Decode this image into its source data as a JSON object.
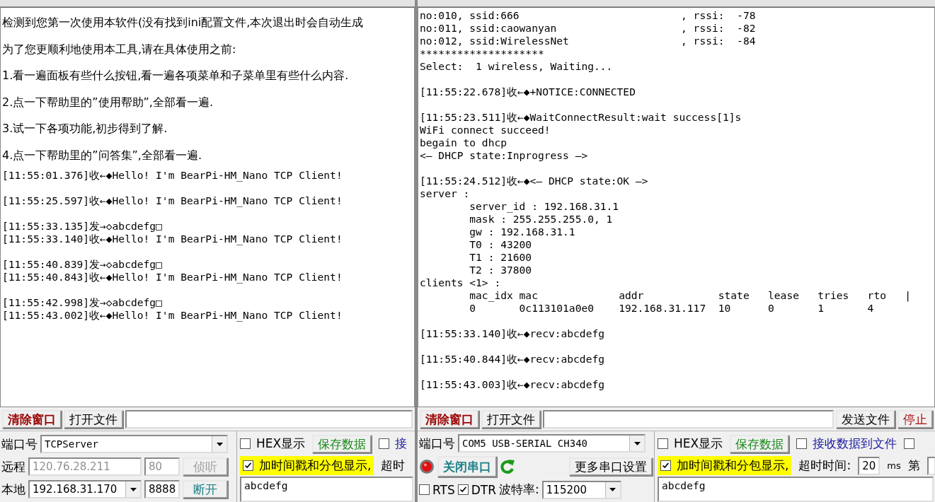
{
  "left_window": {
    "notice": [
      "检测到您第一次使用本软件(没有找到ini配置文件,本次退出时会自动生成",
      "为了您更顺利地使用本工具,请在具体使用之前:",
      "1.看一遍面板有些什么按钮,看一遍各项菜单和子菜单里有些什么内容.",
      "2.点一下帮助里的”使用帮助”,全部看一遍.",
      "3.试一下各项功能,初步得到了解.",
      "4.点一下帮助里的”问答集”,全部看一遍."
    ],
    "log_blocks": [
      [
        "[11:55:01.376]收←◆Hello! I'm BearPi-HM_Nano TCP Client!"
      ],
      [
        "[11:55:25.597]收←◆Hello! I'm BearPi-HM_Nano TCP Client!"
      ],
      [
        "[11:55:33.135]发→◇abcdefg□",
        "[11:55:33.140]收←◆Hello! I'm BearPi-HM_Nano TCP Client!"
      ],
      [
        "[11:55:40.839]发→◇abcdefg□",
        "[11:55:40.843]收←◆Hello! I'm BearPi-HM_Nano TCP Client!"
      ],
      [
        "[11:55:42.998]发→◇abcdefg□",
        "[11:55:43.002]收←◆Hello! I'm BearPi-HM_Nano TCP Client!"
      ]
    ],
    "toolbar": [
      {
        "kind": "button",
        "label": "清除窗口",
        "color": "#990000",
        "emphasis": true
      },
      {
        "kind": "button",
        "label": "打开文件"
      },
      {
        "kind": "field"
      }
    ],
    "port": {
      "label": "端口号",
      "value": "TCPServer"
    },
    "remote": {
      "label": "远程",
      "address": "120.76.28.211",
      "port": "80",
      "button": "侦听",
      "disabled": true
    },
    "local": {
      "label": "本地",
      "address": "192.168.31.170",
      "port": "8888",
      "button": {
        "label": "断开",
        "color": "#1a7f86"
      }
    },
    "options": [
      [
        {
          "kind": "checkbox",
          "label": "HEX显示",
          "checked": false
        },
        {
          "kind": "button",
          "label": "保存数据",
          "color": "#1a8a1a"
        },
        {
          "kind": "checkbox",
          "label": "接",
          "checked": false,
          "color": "#1a1aa0"
        }
      ],
      [
        {
          "kind": "checkbox",
          "label": "加时间戳和分包显示,",
          "checked": true,
          "highlight": true
        },
        {
          "kind": "label",
          "label": "超时"
        }
      ]
    ],
    "send_text": "abcdefg"
  },
  "right_window": {
    "log_blocks": [
      [
        "no:010, ssid:666                          , rssi:  -78",
        "no:011, ssid:caowanyan                    , rssi:  -82",
        "no:012, ssid:WirelessNet                  , rssi:  -84",
        "********************",
        "Select:  1 wireless, Waiting..."
      ],
      [
        "[11:55:22.678]收←◆+NOTICE:CONNECTED"
      ],
      [
        "[11:55:23.511]收←◆WaitConnectResult:wait success[1]s",
        "WiFi connect succeed!",
        "begain to dhcp",
        "<— DHCP state:Inprogress —>"
      ],
      [
        "[11:55:24.512]收←◆<— DHCP state:OK —>",
        "server :",
        "        server_id : 192.168.31.1",
        "        mask : 255.255.255.0, 1",
        "        gw : 192.168.31.1",
        "        T0 : 43200",
        "        T1 : 21600",
        "        T2 : 37800",
        "clients <1> :",
        "        mac_idx mac             addr            state   lease   tries   rto   |",
        "        0       0c113101a0e0    192.168.31.117  10      0       1       4"
      ],
      [
        "[11:55:33.140]收←◆recv:abcdefg"
      ],
      [
        "[11:55:40.844]收←◆recv:abcdefg"
      ],
      [
        "[11:55:43.003]收←◆recv:abcdefg"
      ]
    ],
    "toolbar": [
      {
        "kind": "button",
        "label": "清除窗口",
        "color": "#990000",
        "emphasis": true
      },
      {
        "kind": "button",
        "label": "打开文件"
      },
      {
        "kind": "field"
      },
      {
        "kind": "button",
        "label": "发送文件"
      },
      {
        "kind": "button",
        "label": "停止",
        "color": "#b01010"
      }
    ],
    "port": {
      "label": "端口号",
      "value": "COM5 USB-SERIAL CH340"
    },
    "serial": {
      "open": true,
      "button": {
        "label": "关闭串口",
        "color": "#1a7f86"
      },
      "settings_button": "更多串口设置",
      "rts": {
        "label": "RTS",
        "checked": false
      },
      "dtr": {
        "label": "DTR",
        "checked": true
      },
      "baud_label": "波特率:",
      "baud": "115200"
    },
    "options": [
      [
        {
          "kind": "checkbox",
          "label": "HEX显示",
          "checked": false
        },
        {
          "kind": "button",
          "label": "保存数据",
          "color": "#1a8a1a"
        },
        {
          "kind": "checkbox",
          "label": "接收数据到文件",
          "checked": false,
          "color": "#1a1aa0"
        },
        {
          "kind": "checkbox",
          "checked": false
        }
      ],
      [
        {
          "kind": "checkbox",
          "label": "加时间戳和分包显示,",
          "checked": true,
          "highlight": true
        },
        {
          "kind": "label",
          "label": "超时时间:"
        },
        {
          "kind": "field",
          "value": "20"
        },
        {
          "kind": "unit",
          "label": "ms"
        },
        {
          "kind": "label",
          "label": "第"
        },
        {
          "kind": "field"
        }
      ]
    ],
    "send_text": "abcdefg"
  }
}
